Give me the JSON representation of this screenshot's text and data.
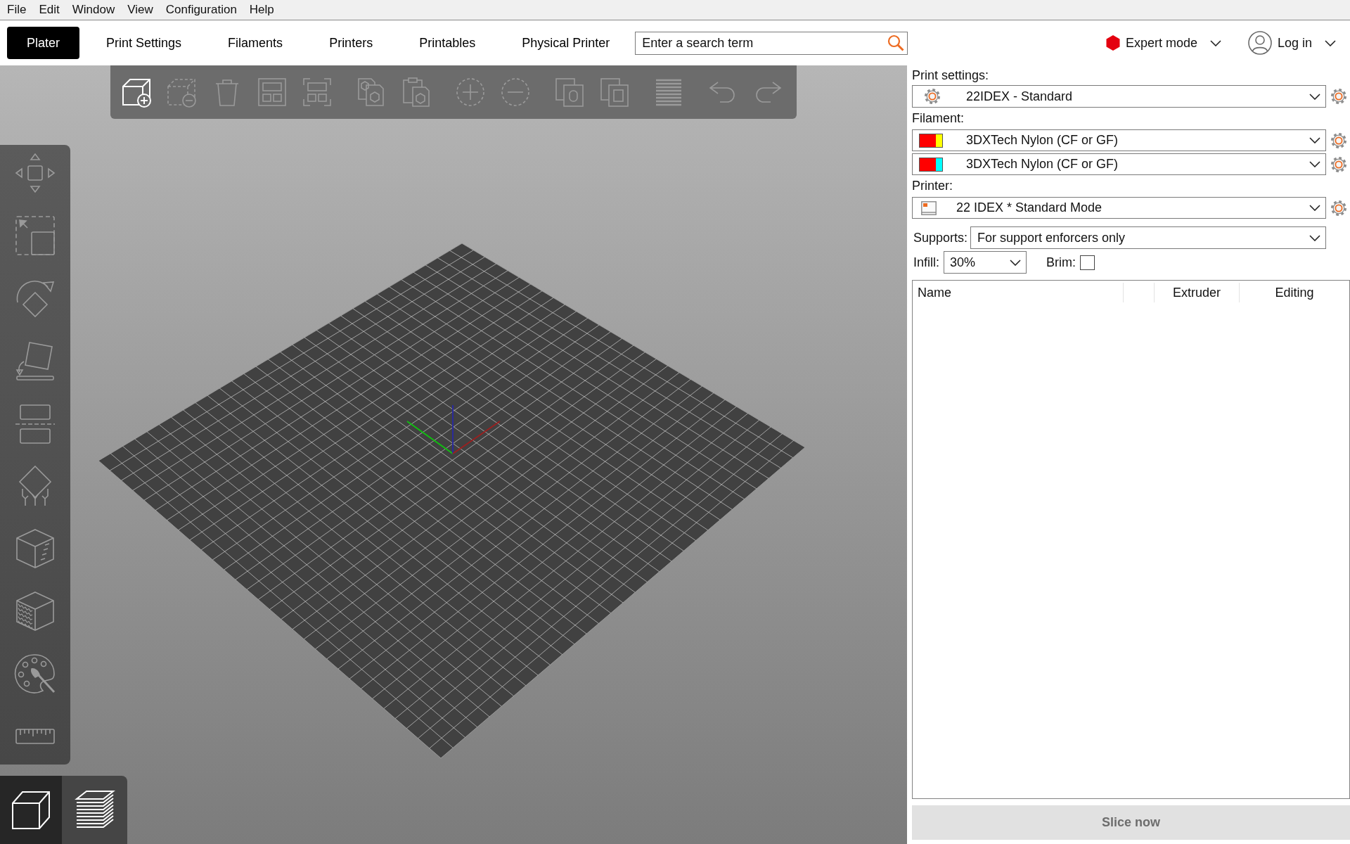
{
  "menu_bar": [
    "File",
    "Edit",
    "Window",
    "View",
    "Configuration",
    "Help"
  ],
  "tabs": [
    {
      "label": "Plater",
      "selected": true
    },
    {
      "label": "Print Settings",
      "selected": false
    },
    {
      "label": "Filaments",
      "selected": false
    },
    {
      "label": "Printers",
      "selected": false
    },
    {
      "label": "Printables",
      "selected": false
    },
    {
      "label": "Physical Printer",
      "selected": false
    }
  ],
  "search": {
    "placeholder": "Enter a search term"
  },
  "mode": {
    "label": "Expert mode"
  },
  "account": {
    "label": "Log in"
  },
  "top_toolbar": [
    [
      {
        "kind": "add",
        "disabled": false
      },
      {
        "kind": "delete",
        "disabled": true
      },
      {
        "kind": "delete_all",
        "disabled": true
      },
      {
        "kind": "arrange",
        "disabled": true
      },
      {
        "kind": "arrange_selection",
        "disabled": true
      }
    ],
    [
      {
        "kind": "copy",
        "disabled": true
      },
      {
        "kind": "paste",
        "disabled": true
      }
    ],
    [
      {
        "kind": "add_instance",
        "disabled": true
      },
      {
        "kind": "remove_instance",
        "disabled": true
      }
    ],
    [
      {
        "kind": "split_objects",
        "disabled": true
      },
      {
        "kind": "split_parts",
        "disabled": true
      }
    ],
    [
      {
        "kind": "layers",
        "disabled": true
      }
    ],
    [
      {
        "kind": "undo",
        "disabled": true
      },
      {
        "kind": "redo",
        "disabled": true
      }
    ]
  ],
  "left_toolbar": [
    {
      "kind": "move"
    },
    {
      "kind": "scale"
    },
    {
      "kind": "rotate"
    },
    {
      "kind": "place_on_face"
    },
    {
      "kind": "cut"
    },
    {
      "kind": "supports"
    },
    {
      "kind": "seam"
    },
    {
      "kind": "fuzzy_skin"
    },
    {
      "kind": "paint"
    },
    {
      "kind": "measure"
    }
  ],
  "view_toggle": [
    {
      "kind": "model",
      "selected": true
    },
    {
      "kind": "preview",
      "selected": false
    }
  ],
  "sidebar": {
    "print_settings": {
      "label": "Print settings:",
      "value": "22IDEX - Standard"
    },
    "filament": {
      "label": "Filament:",
      "items": [
        {
          "value": "3DXTech Nylon (CF or GF)",
          "color": "#ffff00"
        },
        {
          "value": "3DXTech Nylon (CF or GF)",
          "color": "#00ffff"
        }
      ]
    },
    "printer": {
      "label": "Printer:",
      "value": "22 IDEX * Standard Mode"
    },
    "supports": {
      "label": "Supports:",
      "value": "For support enforcers only"
    },
    "infill": {
      "label": "Infill:",
      "value": "30%"
    },
    "brim": {
      "label": "Brim:",
      "checked": false
    },
    "object_list": {
      "columns": [
        "Name",
        "Extruder",
        "Editing"
      ]
    },
    "slice_button": {
      "label": "Slice now",
      "disabled": true
    }
  }
}
